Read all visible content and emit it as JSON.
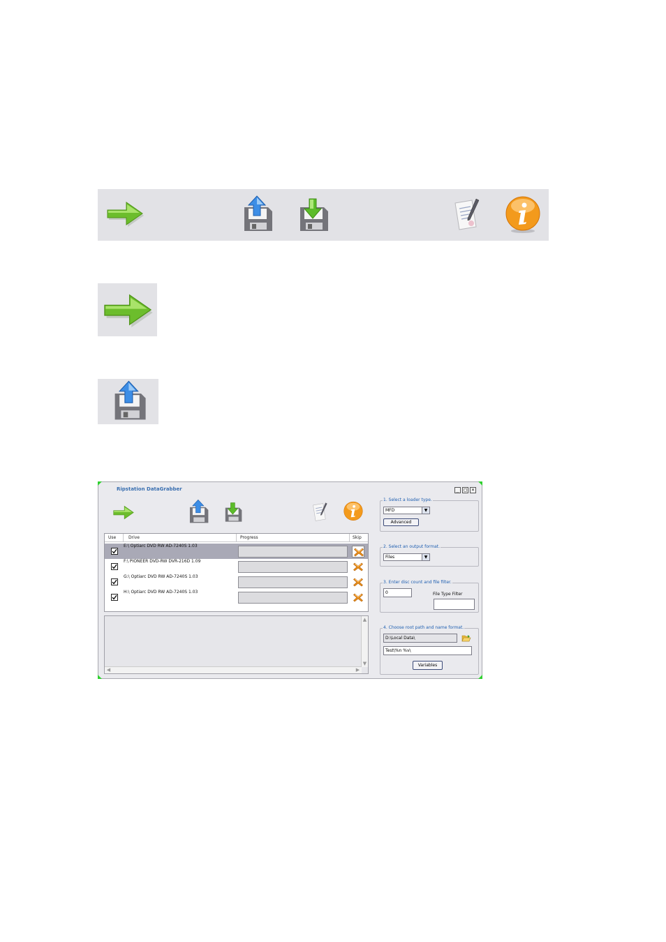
{
  "icons": {
    "go": "arrow-right-icon",
    "upload": "floppy-upload-icon",
    "download": "floppy-download-icon",
    "edit": "document-pen-icon",
    "info": "info-icon"
  },
  "colors": {
    "toolbar_bg": "#e2e2e6",
    "arrow_green": "#6cbd2c",
    "info_orange": "#f39a1c",
    "title_blue": "#3a6fb0",
    "skip_x": "#e8901c"
  },
  "window": {
    "title": "Ripstation DataGrabber",
    "min_label": "_",
    "max_label": "□",
    "close_label": "×"
  },
  "table": {
    "headers": {
      "use": "Use",
      "drive": "Drive",
      "progress": "Progress",
      "skip": "Skip"
    },
    "rows": [
      {
        "drive": "E:\\ Optiarc  DVD RW AD-7240S  1.03",
        "checked": true,
        "selected": true
      },
      {
        "drive": "F:\\ PIONEER  DVD-RW  DVR-216D 1.09",
        "checked": true,
        "selected": false
      },
      {
        "drive": "G:\\ Optiarc  DVD RW AD-7240S  1.03",
        "checked": true,
        "selected": false
      },
      {
        "drive": "H:\\ Optiarc  DVD RW AD-7240S  1.03",
        "checked": true,
        "selected": false
      }
    ]
  },
  "settings": {
    "loader": {
      "label": "1. Select a loader type.",
      "value": "MFD",
      "advanced": "Advanced"
    },
    "output": {
      "label": "2. Select an output format.",
      "value": "Files"
    },
    "disc": {
      "label": "3. Enter disc count and file filter.",
      "count": "0",
      "filter_label": "File Type Filter",
      "filter_value": ""
    },
    "path": {
      "label": "4. Choose root path and name format.",
      "root": "D:\\Local Data\\",
      "format": "Test\\%n %v\\",
      "variables": "Variables"
    }
  }
}
